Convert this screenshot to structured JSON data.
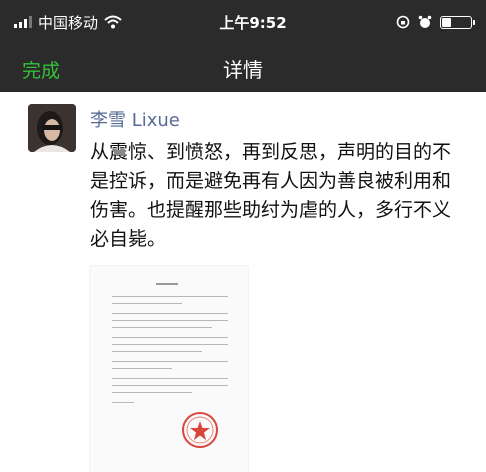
{
  "status_bar": {
    "carrier": "中国移动",
    "time": "上午9:52",
    "signal_bars": 3,
    "battery_level": 0.35,
    "icons": [
      "signal-icon",
      "wifi-icon",
      "rotation-lock-icon",
      "alarm-icon",
      "battery-icon"
    ]
  },
  "nav": {
    "done_label": "完成",
    "title": "详情"
  },
  "post": {
    "author": "李雪 Lixue",
    "text": "从震惊、到愤怒，再到反思，声明的目的不是控诉，而是避免再有人因为善良被利用和伤害。也提醒那些助纣为虐的人，多行不义必自毙。",
    "image": "document-with-red-seal"
  },
  "colors": {
    "bar_bg": "#2b2b2b",
    "done_green": "#35c13a",
    "author_blue": "#576b95",
    "seal_red": "#d9463d"
  }
}
